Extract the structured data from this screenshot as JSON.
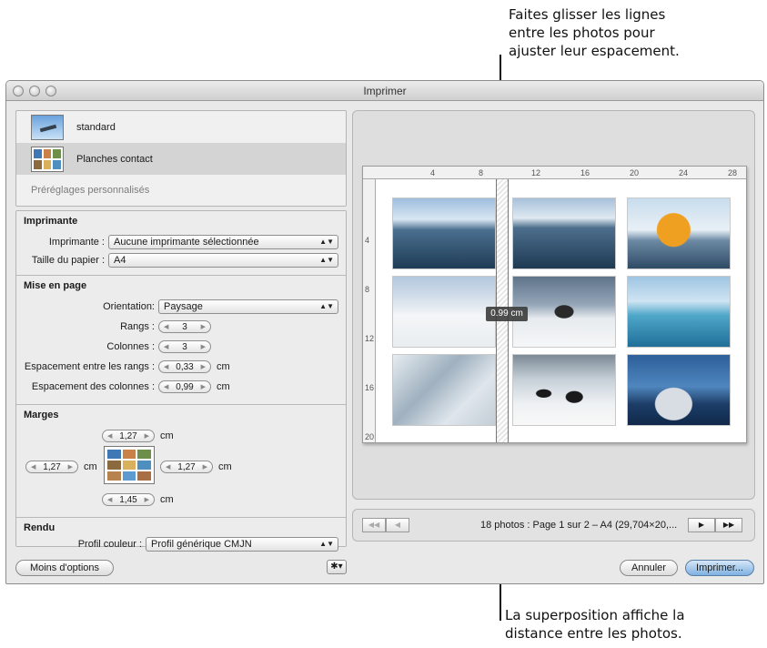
{
  "callouts": {
    "top": [
      "Faites glisser les lignes",
      "entre les photos pour",
      "ajuster leur espacement."
    ],
    "bottom": [
      "La superposition affiche la",
      "distance entre les photos."
    ]
  },
  "window": {
    "title": "Imprimer"
  },
  "presets": {
    "items": [
      {
        "label": "standard",
        "icon": "airplane-thumbnail-icon",
        "selected": false
      },
      {
        "label": "Planches contact",
        "icon": "contact-sheet-thumbnail-icon",
        "selected": true
      }
    ],
    "custom_label": "Préréglages personnalisés"
  },
  "printer": {
    "title": "Imprimante",
    "printer_label": "Imprimante :",
    "printer_value": "Aucune imprimante sélectionnée",
    "paper_label": "Taille du papier :",
    "paper_value": "A4"
  },
  "layout": {
    "title": "Mise en page",
    "orientation_label": "Orientation:",
    "orientation_value": "Paysage",
    "rows_label": "Rangs :",
    "rows_value": "3",
    "cols_label": "Colonnes :",
    "cols_value": "3",
    "row_spacing_label": "Espacement entre les rangs :",
    "row_spacing_value": "0,33",
    "col_spacing_label": "Espacement des colonnes :",
    "col_spacing_value": "0,99",
    "unit": "cm"
  },
  "margins": {
    "title": "Marges",
    "top": "1,27",
    "left": "1,27",
    "right": "1,27",
    "bottom": "1,45",
    "unit": "cm"
  },
  "render": {
    "title": "Rendu",
    "profile_label": "Profil couleur :",
    "profile_value": "Profil générique CMJN"
  },
  "buttons": {
    "fewer_options": "Moins d'options",
    "cancel": "Annuler",
    "print": "Imprimer..."
  },
  "preview": {
    "ruler_top": [
      "4",
      "8",
      "12",
      "16",
      "20",
      "24",
      "28"
    ],
    "ruler_left": [
      "4",
      "8",
      "12",
      "16",
      "20"
    ],
    "overlay": "0.99 cm",
    "status": "18 photos : Page 1 sur 2 – A4 (29,704×20,..."
  },
  "colors": {
    "accent": "#7fb0e2",
    "window_bg": "#e9e9e9"
  }
}
